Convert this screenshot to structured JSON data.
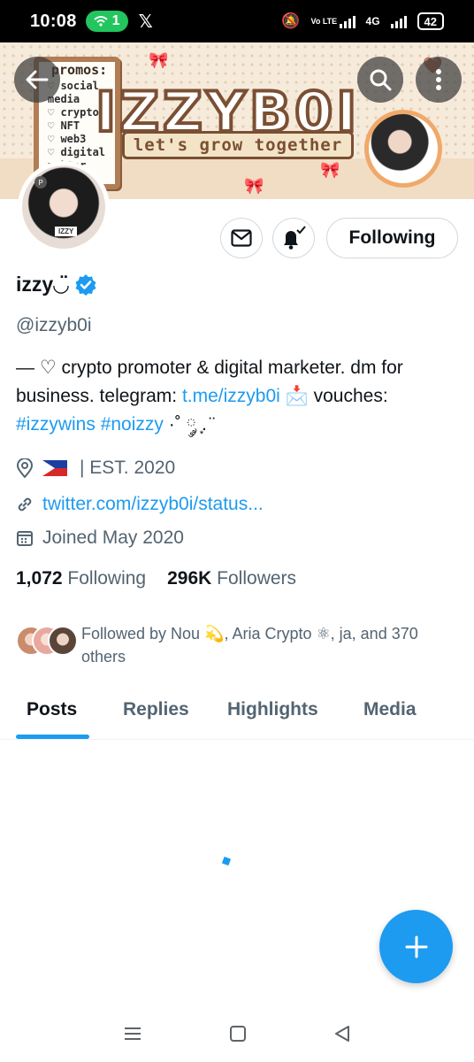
{
  "status_bar": {
    "time": "10:08",
    "wifi_badge": "1",
    "x_app": "𝕏",
    "net_small": "Vo LTE",
    "net_4g": "4G",
    "battery": "42"
  },
  "banner": {
    "board_title": "promos:",
    "board_items": [
      "♡ social",
      "media",
      "♡ crypto",
      "♡ NFT",
      "♡ web3",
      "♡ digital",
      "mrkter"
    ],
    "title": "IZZYB0I",
    "subtitle": "let's grow together"
  },
  "avatar": {
    "tag": "IZZY",
    "badge": "P"
  },
  "actions": {
    "follow_label": "Following"
  },
  "profile": {
    "name": "izzy◡̈",
    "handle": "@izzyb0i",
    "bio_line1": "— ♡ crypto promoter & digital marketer. dm for business. telegram: ",
    "bio_link": "t.me/izzyb0i",
    "bio_mid": " 📩 vouches: ",
    "bio_tag1": "#izzywins",
    "bio_tag2": "#noizzy",
    "bio_end": " ·˚ ༘ ͙. ̈",
    "location": "| EST. 2020",
    "website": "twitter.com/izzyb0i/status...",
    "joined": "Joined May 2020"
  },
  "stats": {
    "following_count": "1,072",
    "following_label": "Following",
    "followers_count": "296K",
    "followers_label": "Followers"
  },
  "followed_by": "Followed by Nou 💫, Aria Crypto ⚛, ja, and 370 others",
  "tabs": [
    "Posts",
    "Replies",
    "Highlights",
    "Media"
  ],
  "colors": {
    "accent": "#1d9bf0",
    "text_primary": "#0f1419",
    "text_secondary": "#536471"
  }
}
